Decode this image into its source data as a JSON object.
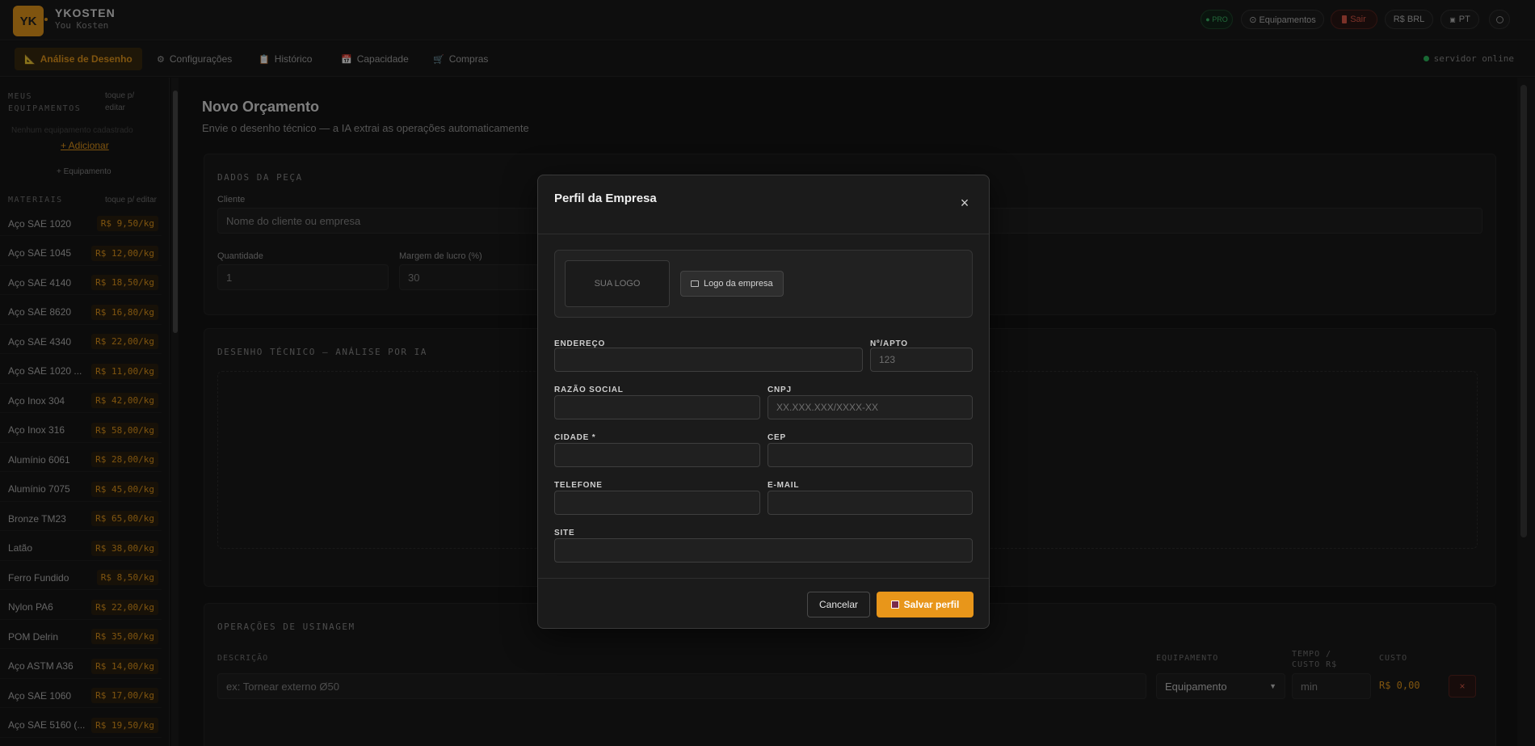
{
  "header": {
    "logo_text": "YK",
    "brand_name": "YKOSTEN",
    "brand_user": "You Kosten",
    "pro_badge": "● PRO",
    "equipamentos": "⊙ Equipamentos",
    "sair": "Sair",
    "currency": "R$ BRL",
    "language": "PT"
  },
  "nav": {
    "tabs": [
      {
        "icon": "📐",
        "label": "Análise de Desenho"
      },
      {
        "icon": "⚙",
        "label": "Configurações"
      },
      {
        "icon": "📋",
        "label": "Histórico"
      },
      {
        "icon": "📅",
        "label": "Capacidade"
      },
      {
        "icon": "🛒",
        "label": "Compras"
      }
    ],
    "server_status": "servidor online"
  },
  "sidebar": {
    "equip_heading": "MEUS EQUIPAMENTOS",
    "equip_hint": "toque p/ editar",
    "equip_empty": "Nenhum equipamento cadastrado",
    "add_link": "+ Adicionar",
    "add_equip": "+ Equipamento",
    "materials_heading": "MATERIAIS",
    "materials_hint": "toque p/ editar",
    "materials": [
      {
        "name": "Aço SAE 1020",
        "price": "R$ 9,50/kg"
      },
      {
        "name": "Aço SAE 1045",
        "price": "R$ 12,00/kg"
      },
      {
        "name": "Aço SAE 4140",
        "price": "R$ 18,50/kg"
      },
      {
        "name": "Aço SAE 8620",
        "price": "R$ 16,80/kg"
      },
      {
        "name": "Aço SAE 4340",
        "price": "R$ 22,00/kg"
      },
      {
        "name": "Aço SAE 1020 ...",
        "price": "R$ 11,00/kg"
      },
      {
        "name": "Aço Inox 304",
        "price": "R$ 42,00/kg"
      },
      {
        "name": "Aço Inox 316",
        "price": "R$ 58,00/kg"
      },
      {
        "name": "Alumínio 6061",
        "price": "R$ 28,00/kg"
      },
      {
        "name": "Alumínio 7075",
        "price": "R$ 45,00/kg"
      },
      {
        "name": "Bronze TM23",
        "price": "R$ 65,00/kg"
      },
      {
        "name": "Latão",
        "price": "R$ 38,00/kg"
      },
      {
        "name": "Ferro Fundido",
        "price": "R$ 8,50/kg"
      },
      {
        "name": "Nylon PA6",
        "price": "R$ 22,00/kg"
      },
      {
        "name": "POM Delrin",
        "price": "R$ 35,00/kg"
      },
      {
        "name": "Aço ASTM A36",
        "price": "R$ 14,00/kg"
      },
      {
        "name": "Aço SAE 1060",
        "price": "R$ 17,00/kg"
      },
      {
        "name": "Aço SAE 5160 (...",
        "price": "R$ 19,50/kg"
      }
    ]
  },
  "main": {
    "title": "Novo Orçamento",
    "subtitle": "Envie o desenho técnico — a IA extrai as operações automaticamente",
    "dados_peca": "DADOS DA PEÇA",
    "cliente_label": "Cliente",
    "cliente_placeholder": "Nome do cliente ou empresa",
    "quantidade_label": "Quantidade",
    "quantidade_value": "1",
    "margem_label": "Margem de lucro (%)",
    "margem_value": "30",
    "desenho_title": "DESENHO TÉCNICO — ANÁLISE POR IA",
    "operacoes_title": "OPERAÇÕES DE USINAGEM",
    "col_descricao": "DESCRIÇÃO",
    "col_equipamento": "EQUIPAMENTO",
    "col_tempo": "TEMPO / CUSTO R$",
    "col_custo": "CUSTO",
    "op_placeholder": "ex: Tornear externo Ø50",
    "op_equip": "Equipamento",
    "op_min": "min",
    "op_cost": "R$ 0,00",
    "op_remove": "×"
  },
  "modal": {
    "title": "Perfil da Empresa",
    "close": "×",
    "logo_placeholder": "SUA LOGO",
    "logo_button": "Logo da empresa",
    "fields": {
      "endereco_label": "ENDEREÇO",
      "numero_label": "Nº/APTO",
      "numero_placeholder": "123",
      "razao_label": "RAZÃO SOCIAL",
      "cnpj_label": "CNPJ",
      "cnpj_placeholder": "XX.XXX.XXX/XXXX-XX",
      "cidade_label": "CIDADE *",
      "cep_label": "CEP",
      "telefone_label": "TELEFONE",
      "email_label": "E-MAIL",
      "site_label": "SITE"
    },
    "cancel": "Cancelar",
    "save": "Salvar perfil"
  },
  "colors": {
    "accent": "#e8961a",
    "background": "#141414",
    "modal_bg": "#1b1b1b",
    "online": "#2fbf5f",
    "danger": "#e05a4a"
  }
}
